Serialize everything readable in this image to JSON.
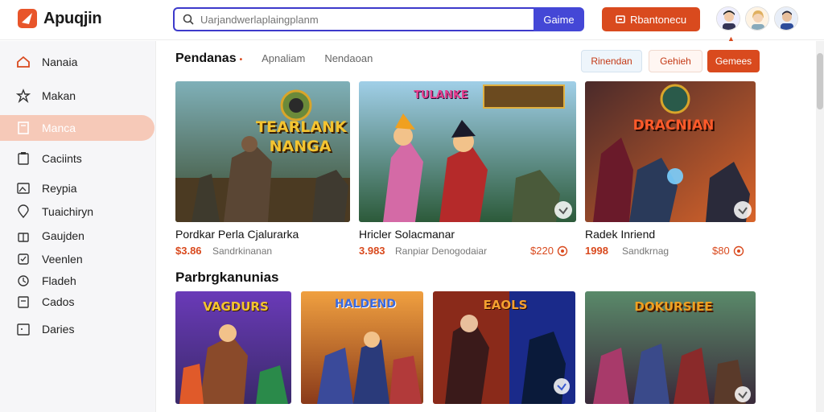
{
  "app": {
    "name": "Apuqjin"
  },
  "search": {
    "placeholder": "Uarjandwerlaplaingplanm",
    "button_label": "Gaime"
  },
  "header": {
    "upgrade_label": "Rbantonecu"
  },
  "sidebar": {
    "items": [
      {
        "label": "Nanaia",
        "icon": "home-icon"
      },
      {
        "label": "Makan",
        "icon": "star-icon"
      },
      {
        "label": "Manca",
        "icon": "book-icon",
        "active": true
      },
      {
        "label": "Caciints",
        "icon": "clipboard-icon"
      },
      {
        "label": "Reypia",
        "icon": "image-icon"
      },
      {
        "label": "Tuaichiryn",
        "icon": "location-icon"
      },
      {
        "label": "Gaujden",
        "icon": "gift-icon"
      },
      {
        "label": "Veenlen",
        "icon": "tag-icon"
      },
      {
        "label": "Fladeh",
        "icon": "history-icon"
      },
      {
        "label": "Cados",
        "icon": "gamepad-icon"
      },
      {
        "label": "Daries",
        "icon": "calendar-icon"
      }
    ]
  },
  "tabs": {
    "main": "Pendanas",
    "t2": "Apnaliam",
    "t3": "Nendaoan"
  },
  "filters": {
    "f1": "Rinendan",
    "f2": "Gehieh",
    "f3": "Gemees"
  },
  "featured": [
    {
      "title": "Pordkar Perla Cjalurarka",
      "price": "$3.86",
      "sub": "Sandrkinanan",
      "art": "TEARLANK NANGA",
      "right_price": ""
    },
    {
      "title": "Hricler Solacmanar",
      "price": "3.983",
      "sub": "Ranpiar Denogodaiar",
      "art": "TULANKE",
      "right_price": "$220"
    },
    {
      "title": "Radek Inriend",
      "price": "1998",
      "sub": "Sandkrnag",
      "art": "DRACNIAN",
      "right_price": "$80"
    }
  ],
  "section2": {
    "title": "Parbrgkanunias"
  },
  "grid": [
    {
      "art": "VAGDURS"
    },
    {
      "art": "HALDEND"
    },
    {
      "art": "EAOLS"
    },
    {
      "art": "DOKURSIEE"
    }
  ],
  "colors": {
    "accent": "#d94a1e",
    "brand_blue": "#4447d6",
    "active_bg": "#f6c9b8"
  }
}
